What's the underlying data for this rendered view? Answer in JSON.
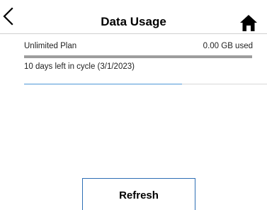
{
  "header": {
    "title": "Data Usage",
    "back_icon": "chevron-left-icon",
    "home_icon": "home-icon"
  },
  "plan": {
    "name": "Unlimited Plan",
    "usage": "0.00 GB used",
    "usage_fraction": 0,
    "cycle_text": "10 days left in cycle (3/1/2023)"
  },
  "refresh_progress_fraction": 0.65,
  "refresh_button": {
    "label": "Refresh"
  },
  "colors": {
    "accent": "#2e6fb5",
    "bar_track": "#9d9d9d",
    "progress": "#4d97d6"
  }
}
